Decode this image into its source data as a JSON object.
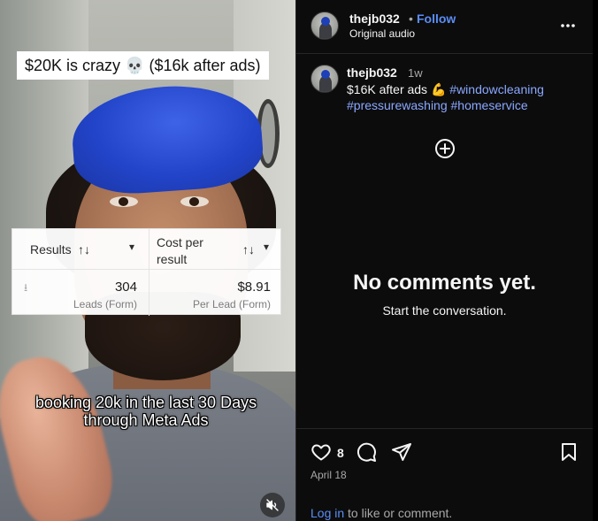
{
  "video": {
    "caption_top": "$20K is crazy 💀 ($16k after ads)",
    "stats_card": {
      "col1_header": "Results",
      "col2_header": "Cost per result",
      "sort_icon": "↑↓",
      "dropdown_icon": "▾",
      "download_icon": "⭳",
      "results_value": "304",
      "results_sub": "Leads (Form)",
      "cost_value": "$8.91",
      "cost_sub": "Per Lead (Form)"
    },
    "subtitle": "booking 20k in the last 30 Days through Meta Ads",
    "mute_icon": "muted-speaker-icon"
  },
  "header": {
    "username": "thejb032",
    "separator": "•",
    "follow_label": "Follow",
    "audio_label": "Original audio"
  },
  "post": {
    "username": "thejb032",
    "time_ago": "1w",
    "text": "$16K after ads 💪",
    "hashtags": [
      "#windowcleaning",
      "#pressurewashing",
      "#homeservice"
    ]
  },
  "comments": {
    "empty_title": "No comments yet.",
    "empty_subtitle": "Start the conversation."
  },
  "footer": {
    "like_count": "8",
    "date": "April 18",
    "login_link": "Log in",
    "login_suffix": " to like or comment."
  },
  "colors": {
    "link_blue": "#5b8df6",
    "hashtag_blue": "#8aa8ff",
    "panel_bg": "#0c0c0c"
  }
}
